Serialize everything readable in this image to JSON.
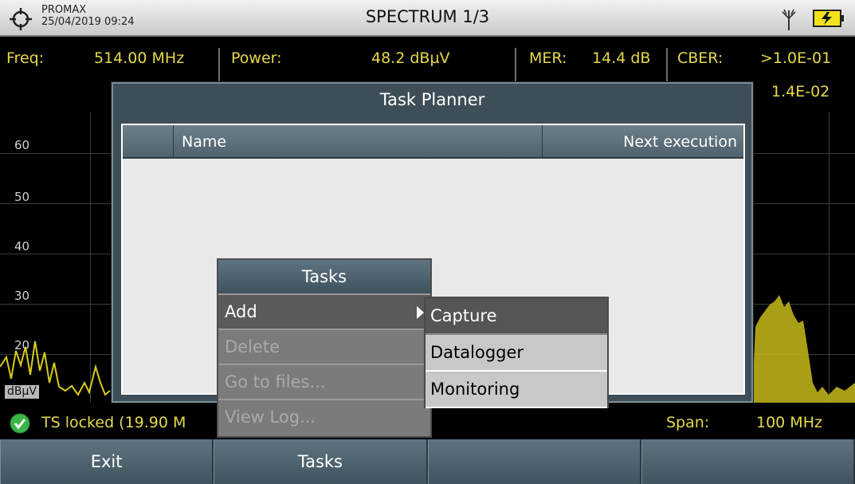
{
  "header": {
    "brand": "PROMAX",
    "datetime": "25/04/2019 09:24",
    "title": "SPECTRUM 1/3",
    "icons": [
      "crosshair-icon",
      "antenna-icon",
      "battery-charging-icon"
    ]
  },
  "measurements": {
    "freq_label": "Freq:",
    "freq_value": "514.00 MHz",
    "power_label": "Power:",
    "power_value": "48.2 dBµV",
    "mer_label": "MER:",
    "mer_value": "14.4 dB",
    "cber_label": "CBER:",
    "cber_value": ">1.0E-01",
    "vber_value": "1.4E-02"
  },
  "plot": {
    "y_ticks": [
      "60",
      "50",
      "40",
      "30",
      "20"
    ],
    "unit": "dBµV",
    "trace_color": "#d9cc1a"
  },
  "status": {
    "locked_text": "TS locked (19.90 M",
    "span_label": "Span:",
    "span_value": "100 MHz"
  },
  "softkeys": [
    "Exit",
    "Tasks",
    "",
    ""
  ],
  "task_planner": {
    "title": "Task Planner",
    "columns": [
      "",
      "Name",
      "Next execution"
    ],
    "rows": []
  },
  "tasks_menu": {
    "title": "Tasks",
    "items": [
      {
        "label": "Add",
        "enabled": true,
        "has_submenu": true
      },
      {
        "label": "Delete",
        "enabled": false
      },
      {
        "label": "Go to files...",
        "enabled": false
      },
      {
        "label": "View Log...",
        "enabled": false
      }
    ]
  },
  "add_submenu": {
    "items": [
      "Capture",
      "Datalogger",
      "Monitoring"
    ],
    "selected": "Capture"
  },
  "colors": {
    "measurement_text": "#e6d84a",
    "softkey_bg": "#4f626d",
    "locked_check": "#3ab54a"
  }
}
